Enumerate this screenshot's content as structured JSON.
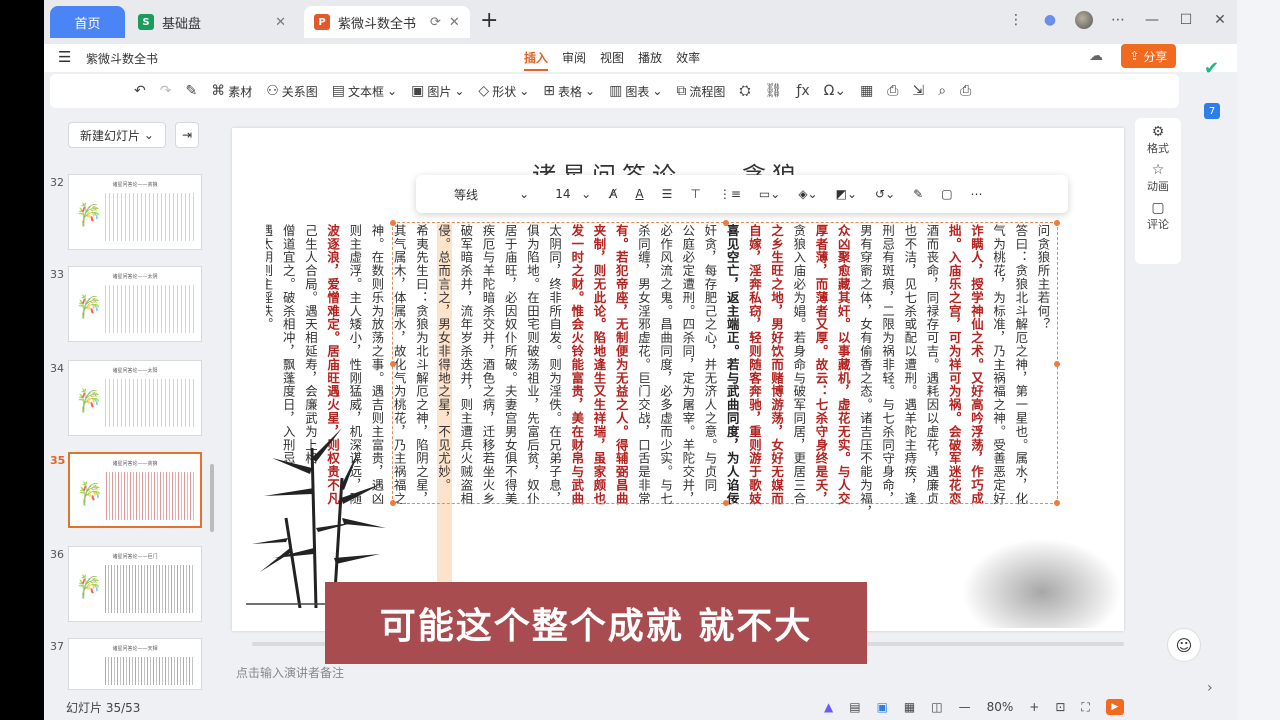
{
  "tabs": {
    "home": "首页",
    "sheet": "基础盘",
    "ppt": "紫微斗数全书",
    "sheet_icon": "S",
    "ppt_icon": "P",
    "close": "✕"
  },
  "menubar": {
    "doc_title": "紫微斗数全书",
    "menus": [
      "插入",
      "审阅",
      "视图",
      "播放",
      "效率"
    ],
    "share": "分享"
  },
  "toolbar": [
    "素材",
    "关系图",
    "文本框",
    "图片",
    "形状",
    "表格",
    "图表",
    "流程图"
  ],
  "sidebar": {
    "new_slide": "新建幻灯片",
    "thumbs": [
      {
        "num": "32",
        "title": "诸星问答论——贪狼"
      },
      {
        "num": "33",
        "title": "诸星问答论——太阴"
      },
      {
        "num": "34",
        "title": "诸星问答论——太阳"
      },
      {
        "num": "35",
        "title": "诸星问答论——贪狼"
      },
      {
        "num": "36",
        "title": "诸星问答论——巨门"
      },
      {
        "num": "37",
        "title": "诸星问答论——天相"
      }
    ]
  },
  "slide": {
    "title": "诸星问答论——贪狼",
    "columns": [
      {
        "t": "问贪狼所主若何？",
        "s": "n"
      },
      {
        "t": "答曰：贪狼北斗解厄之神，第一星也。属水，化",
        "s": "n"
      },
      {
        "t": "气为桃花，为标准，乃主祸福之神。受善恶定好",
        "s": "n"
      },
      {
        "t": "诈瞒人，授学神仙之术。又好高吟浮荡，作巧成",
        "s": "r"
      },
      {
        "t": "拙。入庙乐之宫，可为祥可为祸。会破军迷花恋",
        "s": "r"
      },
      {
        "t": "酒而丧命，同禄存可吉。遇耗因以虚花，遇廉贞",
        "s": "n"
      },
      {
        "t": "也不洁，见七杀或配以遭刑。遇羊陀主痔疾，逢",
        "s": "n"
      },
      {
        "t": "刑忌有斑痕，二限为祸非轻。与七杀同守身命，",
        "s": "n"
      },
      {
        "t": "男有穿窬之体，女有偷香之态。诸吉压不能为福，",
        "s": "n"
      },
      {
        "t": "众凶聚愈藏其奸。以事藏机，虚花无实。与人交",
        "s": "r"
      },
      {
        "t": "厚者薄，而薄者又厚。故云：七杀守身终是夭，",
        "s": "r"
      },
      {
        "t": "贪狼入庙必为娼。若身命与破军同居，更居三合",
        "s": "n"
      },
      {
        "t": "之乡生旺之地，男好饮而赌博游荡，女好无媒而",
        "s": "r"
      },
      {
        "t": "自嫁，淫奔私窃，轻则随客奔驰，重则游于歌妓",
        "s": "r"
      },
      {
        "t": "喜见空亡，返主端正。若与武曲同度，为人谄佞",
        "s": "b"
      },
      {
        "t": "奸贪，每存肥己之心，并无济人之意。与贞同",
        "s": "n"
      },
      {
        "t": "公庭必定遭刑。四杀同，定为屠宰。羊陀交并，",
        "s": "n"
      },
      {
        "t": "必作风流之鬼。昌曲同度，必多虚而少实。与七",
        "s": "n"
      },
      {
        "t": "杀同缠，男女淫邪虚花。巨门交战，口舌是非常",
        "s": "n"
      },
      {
        "t": "有。若犯帝座，无制便为无益之人。得辅弼昌曲",
        "s": "r"
      },
      {
        "t": "夹制，则无此论。陷地逢生又生祥瑞，虽家颇也",
        "s": "r"
      },
      {
        "t": "发一时之财。惟会火铃能富贵，美在财帛与武曲",
        "s": "r"
      },
      {
        "t": "太阴同，终非所自发。则为淫佚。在兄弟子息，",
        "s": "n"
      },
      {
        "t": "俱为陷地。在田宅则破荡祖业，先富后贫，奴仆",
        "s": "n"
      },
      {
        "t": "居于庙旺，必因奴仆所破。夫妻宫男女俱不得美",
        "s": "n"
      },
      {
        "t": "疾厄与羊陀暗杀交并，酒色之病，迁移若坐火乡",
        "s": "n"
      },
      {
        "t": "破军暗杀并，流年岁杀迭并，则主遭兵火贼盗相",
        "s": "n"
      },
      {
        "t": "侵。总而言之，男女非得地之星，不见尤妙。",
        "s": "h"
      },
      {
        "t": "希夷先生曰：贪狼为北斗解厄之神，陷阴之星，",
        "s": "n"
      },
      {
        "t": "其气属木，体属水，故化气为桃花，乃主祸福之",
        "s": "n"
      },
      {
        "t": "神。在数则乐为放荡之事。遇吉则主富贵，遇凶",
        "s": "n"
      },
      {
        "t": "则主虚浮。主人矮小，性刚猛威，机深谋远，随",
        "s": "n"
      },
      {
        "t": "波逐浪，爱憎难定。居庙旺遇火星，则权贵不凡",
        "s": "r"
      },
      {
        "t": "己生人合局。遇天相延寿，会廉武为上格",
        "s": "n"
      },
      {
        "t": "僧道宜之。破杀相冲，飘蓬度日，入刑忌",
        "s": "n"
      },
      {
        "t": "遇太阴则主淫佚。",
        "s": "n"
      }
    ]
  },
  "floatbar": {
    "font": "等线",
    "size": "14"
  },
  "caption": "可能这个整个成就  就不大",
  "notes_placeholder": "点击输入演讲者备注",
  "status": {
    "slide_num": "幻灯片 35/53",
    "zoom": "80%"
  },
  "rightpanel": {
    "format": "格式",
    "anim": "动画",
    "comment": "评论"
  }
}
